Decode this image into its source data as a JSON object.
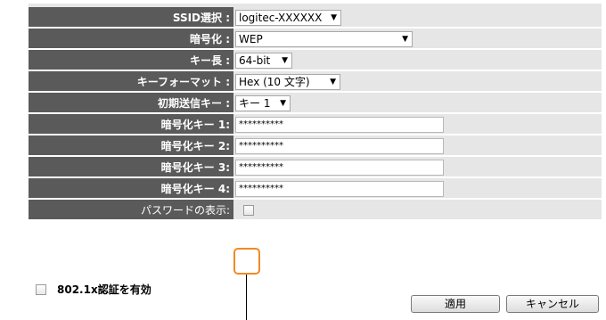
{
  "settings": {
    "ssid": {
      "label": "SSID選択 :",
      "value": "logitec-XXXXXX"
    },
    "encryption": {
      "label": "暗号化 :",
      "value": "WEP"
    },
    "key_length": {
      "label": "キー長 :",
      "value": "64-bit"
    },
    "key_format": {
      "label": "キーフォーマット :",
      "value": "Hex (10 文字)"
    },
    "default_tx_key": {
      "label": "初期送信キー :",
      "value": "キー 1"
    },
    "key1": {
      "label": "暗号化キー 1:",
      "value": "**********"
    },
    "key2": {
      "label": "暗号化キー 2:",
      "value": "**********"
    },
    "key3": {
      "label": "暗号化キー 3:",
      "value": "**********"
    },
    "key4": {
      "label": "暗号化キー 4:",
      "value": "**********"
    },
    "show_password": {
      "label": "パスワードの表示:",
      "checked": false
    }
  },
  "options": {
    "enable_8021x": {
      "label": "802.1x認証を有効",
      "checked": false
    }
  },
  "buttons": {
    "apply": "適用",
    "cancel": "キャンセル"
  },
  "colors": {
    "label_bg": "#5a5a5a",
    "row_bg": "#e6e6e6",
    "highlight": "#f08a24"
  },
  "icons": {
    "dropdown": "dropdown-caret-icon"
  }
}
